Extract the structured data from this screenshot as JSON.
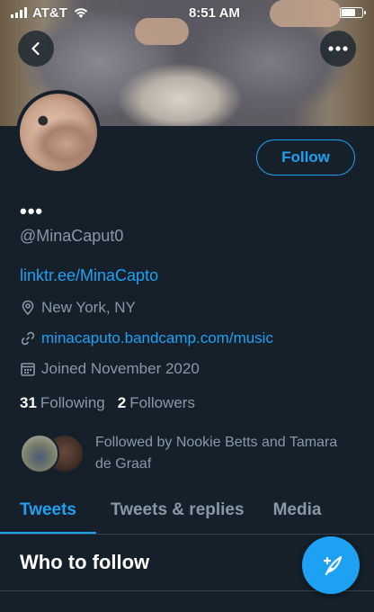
{
  "status_bar": {
    "carrier": "AT&T",
    "time": "8:51 AM"
  },
  "profile": {
    "name": "•••",
    "handle": "@MinaCaput0",
    "bio_link": "linktr.ee/MinaCapto",
    "location": "New York, NY",
    "website": "minacaputo.bandcamp.com/music",
    "joined": "Joined November 2020",
    "following_count": "31",
    "following_label": "Following",
    "followers_count": "2",
    "followers_label": "Followers",
    "followed_by": "Followed by Nookie Betts and Tamara de Graaf"
  },
  "actions": {
    "follow_label": "Follow"
  },
  "tabs": [
    {
      "label": "Tweets",
      "active": true
    },
    {
      "label": "Tweets & replies",
      "active": false
    },
    {
      "label": "Media",
      "active": false
    }
  ],
  "who_to_follow": {
    "heading": "Who to follow"
  },
  "icons": {
    "back": "back-arrow-icon",
    "more": "more-icon",
    "location": "location-pin-icon",
    "link": "link-icon",
    "calendar": "calendar-icon",
    "compose": "compose-tweet-icon"
  },
  "colors": {
    "background": "#15202b",
    "accent": "#1da1f2",
    "secondary_text": "#8899a6"
  }
}
